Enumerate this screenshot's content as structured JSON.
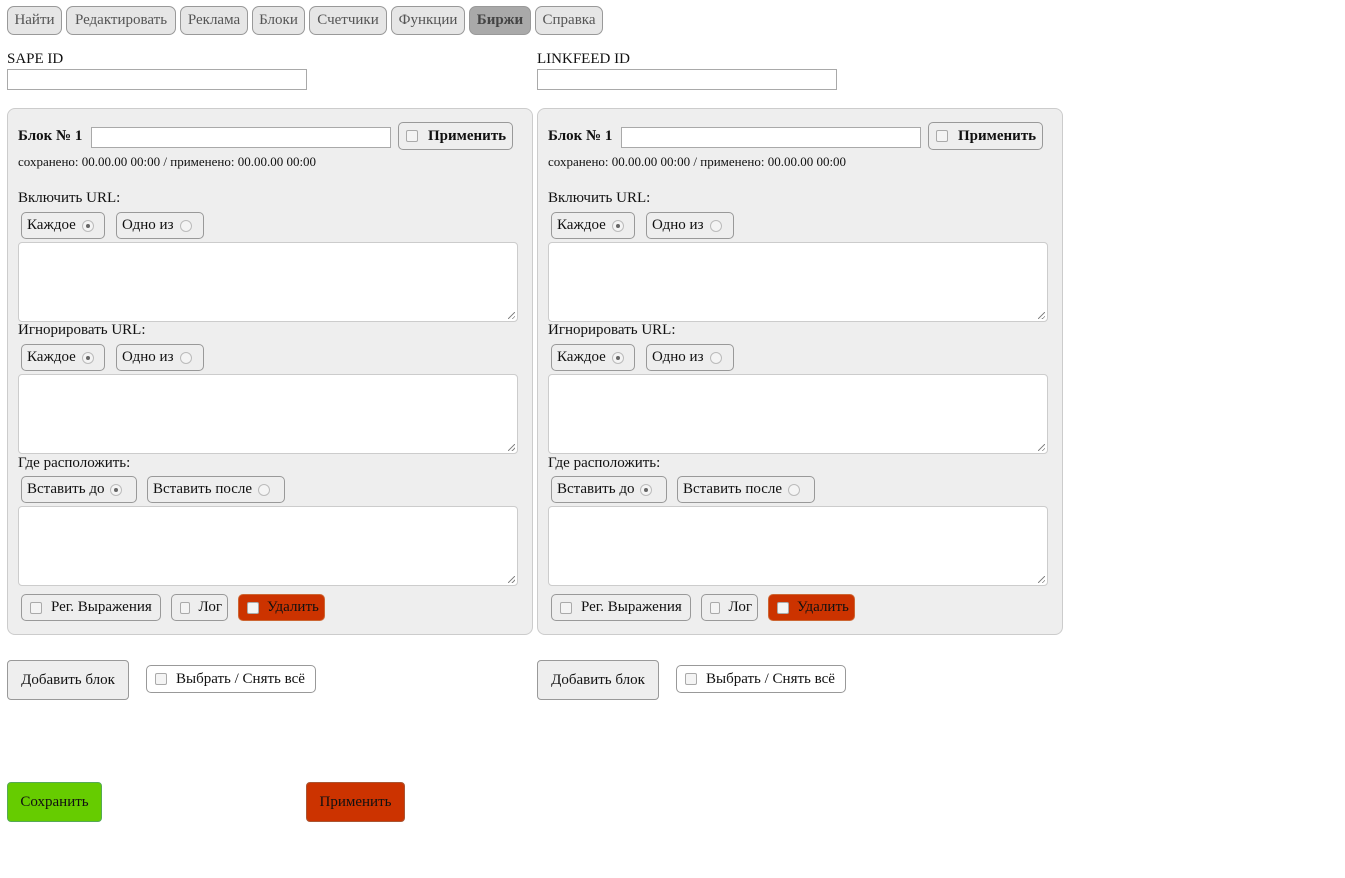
{
  "tabs": [
    {
      "label": "Найти",
      "active": false
    },
    {
      "label": "Редактировать",
      "active": false
    },
    {
      "label": "Реклама",
      "active": false
    },
    {
      "label": "Блоки",
      "active": false
    },
    {
      "label": "Счетчики",
      "active": false
    },
    {
      "label": "Функции",
      "active": false
    },
    {
      "label": "Биржи",
      "active": true
    },
    {
      "label": "Справка",
      "active": false
    }
  ],
  "columns": [
    {
      "id_label": "SAPE ID",
      "id_value": "",
      "block": {
        "title": "Блок № 1",
        "name_value": "",
        "apply_label": "Применить",
        "status": "сохранено: 00.00.00 00:00 / применено: 00.00.00 00:00",
        "include_label": "Включить URL:",
        "include_opts": [
          "Каждое",
          "Одно из"
        ],
        "include_value": "",
        "ignore_label": "Игнорировать URL:",
        "ignore_opts": [
          "Каждое",
          "Одно из"
        ],
        "ignore_value": "",
        "where_label": "Где расположить:",
        "where_opts": [
          "Вставить до",
          "Вставить после"
        ],
        "where_value": "",
        "regex_label": "Рег. Выражения",
        "log_label": "Лог",
        "delete_label": "Удалить"
      },
      "add_block_label": "Добавить блок",
      "select_all_label": "Выбрать / Снять всё"
    },
    {
      "id_label": "LINKFEED ID",
      "id_value": "",
      "block": {
        "title": "Блок № 1",
        "name_value": "",
        "apply_label": "Применить",
        "status": "сохранено: 00.00.00 00:00 / применено: 00.00.00 00:00",
        "include_label": "Включить URL:",
        "include_opts": [
          "Каждое",
          "Одно из"
        ],
        "include_value": "",
        "ignore_label": "Игнорировать URL:",
        "ignore_opts": [
          "Каждое",
          "Одно из"
        ],
        "ignore_value": "",
        "where_label": "Где расположить:",
        "where_opts": [
          "Вставить до",
          "Вставить после"
        ],
        "where_value": "",
        "regex_label": "Рег. Выражения",
        "log_label": "Лог",
        "delete_label": "Удалить"
      },
      "add_block_label": "Добавить блок",
      "select_all_label": "Выбрать / Снять всё"
    }
  ],
  "footer": {
    "save_label": "Сохранить",
    "apply_label": "Применить"
  },
  "colors": {
    "save": "#66cc00",
    "danger": "#cc3300"
  }
}
